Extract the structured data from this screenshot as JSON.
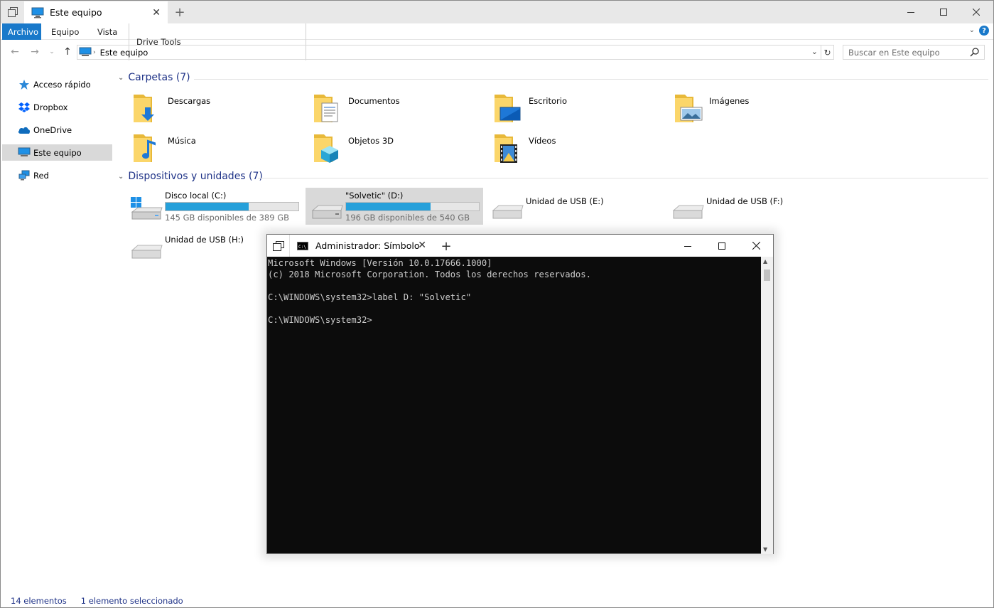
{
  "explorer": {
    "tab_title": "Este equipo",
    "ribbon": {
      "file": "Archivo",
      "tabs": [
        "Equipo",
        "Vista",
        "Drive Tools"
      ]
    },
    "address": "Este equipo",
    "search_placeholder": "Buscar en Este equipo",
    "nav": [
      {
        "label": "Acceso rápido",
        "icon": "star-icon"
      },
      {
        "label": "Dropbox",
        "icon": "dropbox-icon"
      },
      {
        "label": "OneDrive",
        "icon": "cloud-icon"
      },
      {
        "label": "Este equipo",
        "icon": "computer-icon",
        "selected": true
      },
      {
        "label": "Red",
        "icon": "network-icon"
      }
    ],
    "folders_group": "Carpetas (7)",
    "folders": [
      {
        "label": "Descargas",
        "icon": "downloads-folder-icon"
      },
      {
        "label": "Documentos",
        "icon": "documents-folder-icon"
      },
      {
        "label": "Escritorio",
        "icon": "desktop-folder-icon"
      },
      {
        "label": "Imágenes",
        "icon": "pictures-folder-icon"
      },
      {
        "label": "Música",
        "icon": "music-folder-icon"
      },
      {
        "label": "Objetos 3D",
        "icon": "3d-objects-folder-icon"
      },
      {
        "label": "Vídeos",
        "icon": "videos-folder-icon"
      }
    ],
    "devices_group": "Dispositivos y unidades (7)",
    "drives": [
      {
        "label": "Disco local (C:)",
        "free": "145 GB disponibles de 389 GB",
        "used_fraction": 0.627,
        "system": true
      },
      {
        "label": "\"Solvetic\" (D:)",
        "free": "196 GB disponibles de 540 GB",
        "used_fraction": 0.637,
        "selected": true
      },
      {
        "label": "Unidad de USB (E:)"
      },
      {
        "label": "Unidad de USB (F:)"
      },
      {
        "label": "Unidad de USB (H:)"
      }
    ],
    "status": {
      "count": "14 elementos",
      "selection": "1 elemento seleccionado"
    }
  },
  "cmd": {
    "tab_title": "Administrador: Símbolo del sistema",
    "lines": [
      "Microsoft Windows [Versión 10.0.17666.1000]",
      "(c) 2018 Microsoft Corporation. Todos los derechos reservados.",
      "",
      "C:\\WINDOWS\\system32>label D: \"Solvetic\"",
      "",
      "C:\\WINDOWS\\system32>"
    ]
  },
  "colors": {
    "accent": "#1979ca",
    "progress": "#26a0da",
    "group_heading": "#1e3287",
    "selection": "#d9d9d9"
  }
}
